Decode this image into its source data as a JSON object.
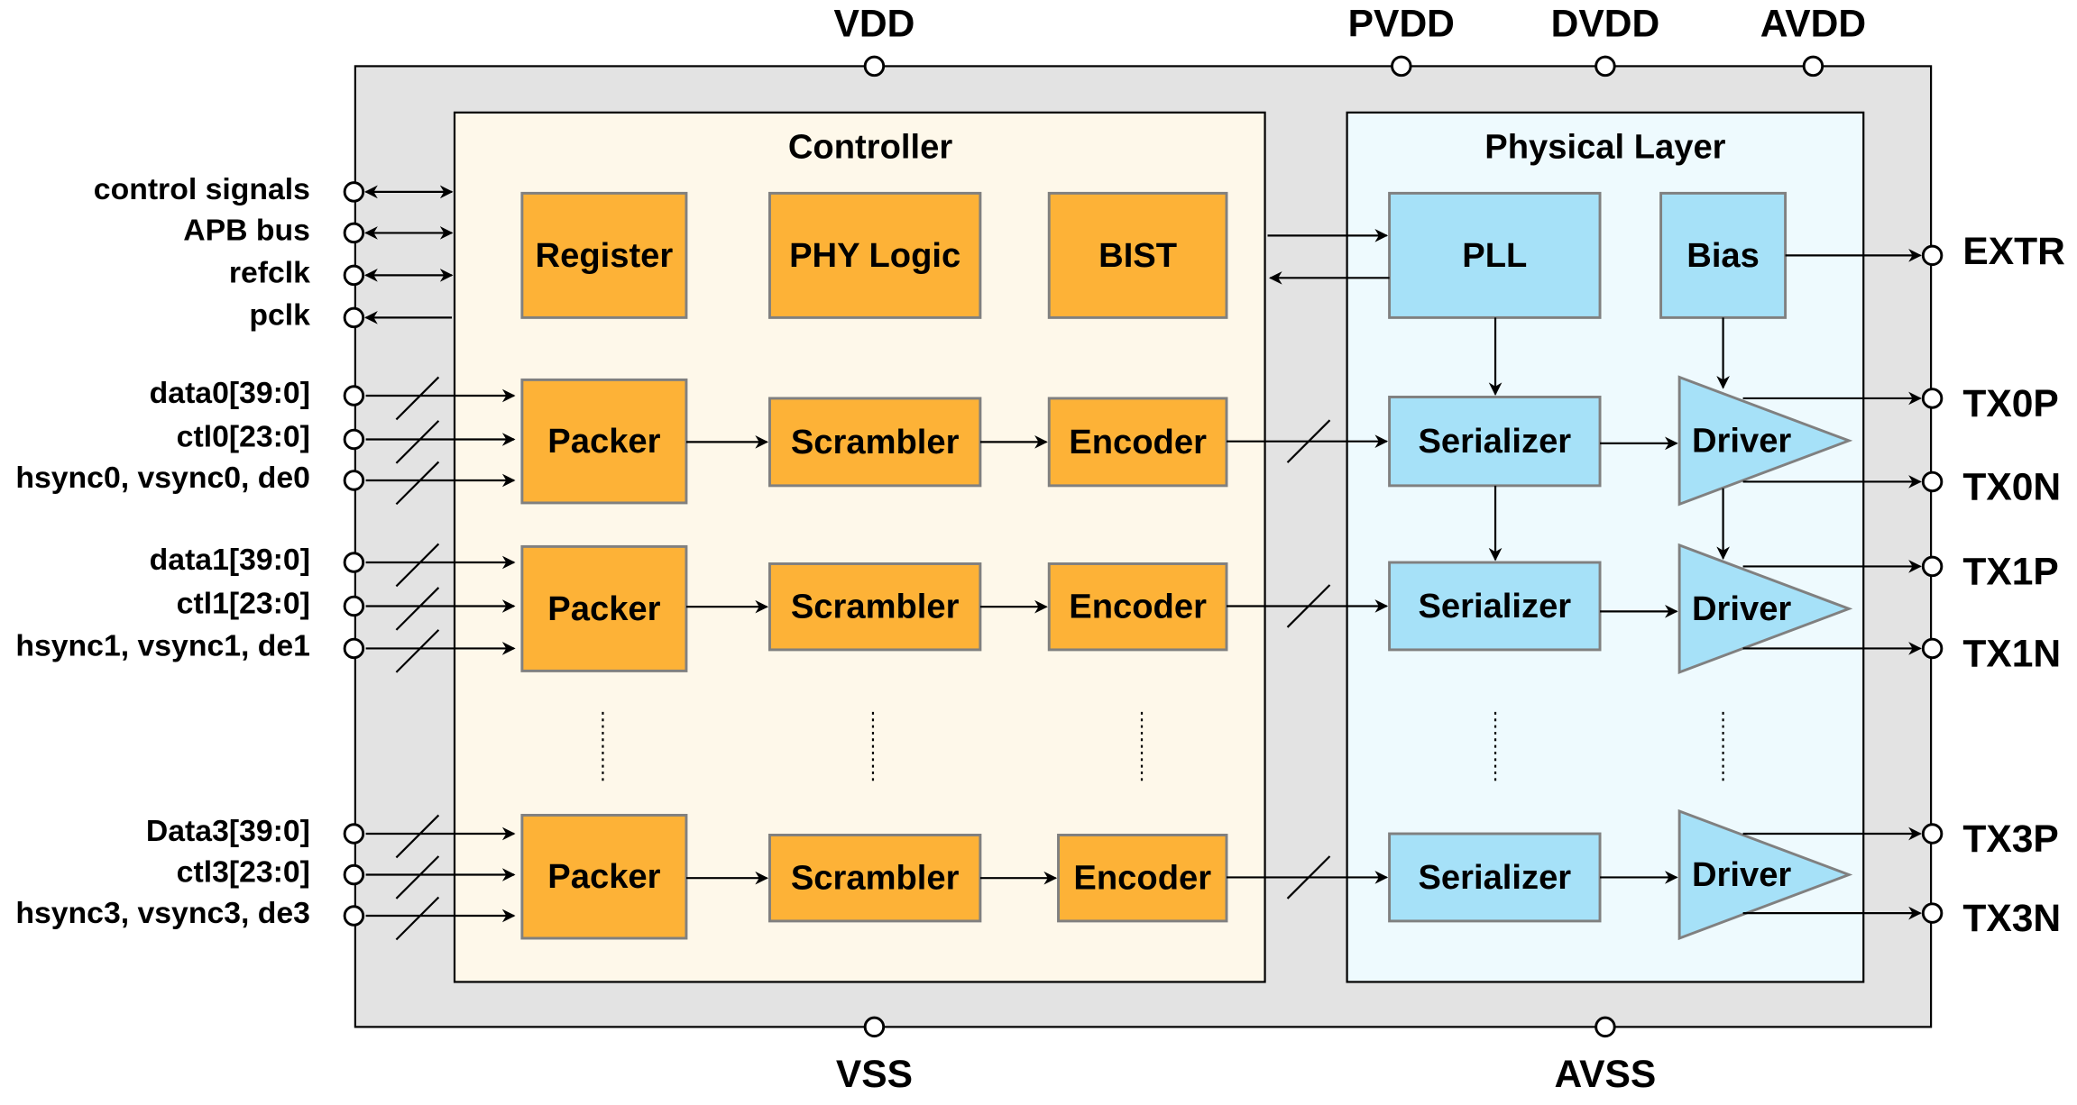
{
  "colors": {
    "chip_fill": "#e3e3e3",
    "controller_fill": "#fef8ea",
    "phy_fill": "#eefafe",
    "controller_block": "#fdb237",
    "phy_block": "#a6e1f8",
    "block_stroke": "#808080"
  },
  "supply_pins": {
    "top": [
      "VDD",
      "PVDD",
      "DVDD",
      "AVDD"
    ],
    "bottom": [
      "VSS",
      "AVSS"
    ]
  },
  "controller": {
    "title": "Controller",
    "top_blocks": [
      "Register",
      "PHY Logic",
      "BIST"
    ],
    "lane_blocks": [
      "Packer",
      "Scrambler",
      "Encoder"
    ]
  },
  "phy": {
    "title": "Physical Layer",
    "pll": "PLL",
    "bias": "Bias",
    "serializer": "Serializer",
    "driver": "Driver"
  },
  "left_pins": {
    "control": [
      "control signals",
      "APB bus",
      "refclk",
      "pclk"
    ],
    "lanes": [
      [
        "data0[39:0]",
        "ctl0[23:0]",
        "hsync0, vsync0, de0"
      ],
      [
        "data1[39:0]",
        "ctl1[23:0]",
        "hsync1, vsync1, de1"
      ],
      [
        "Data3[39:0]",
        "ctl3[23:0]",
        "hsync3, vsync3, de3"
      ]
    ]
  },
  "right_pins": {
    "extr": "EXTR",
    "lanes": [
      [
        "TX0P",
        "TX0N"
      ],
      [
        "TX1P",
        "TX1N"
      ],
      [
        "TX3P",
        "TX3N"
      ]
    ]
  }
}
